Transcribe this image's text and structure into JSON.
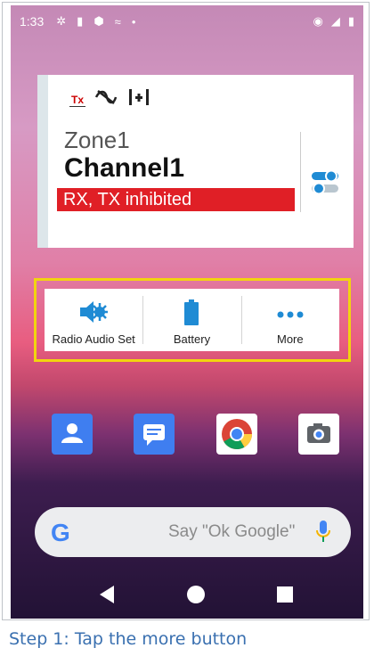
{
  "statusbar": {
    "time": "1:33"
  },
  "widget": {
    "zone": "Zone1",
    "channel": "Channel1",
    "status": "RX, TX inhibited",
    "tx_indicator": "Tx"
  },
  "actions": [
    {
      "label": "Radio Audio Set",
      "icon": "speaker-gear-icon"
    },
    {
      "label": "Battery",
      "icon": "battery-icon"
    },
    {
      "label": "More",
      "icon": "more-dots-icon"
    }
  ],
  "apps": [
    {
      "name": "contacts",
      "icon": "contacts-icon",
      "color": "#3f7ef0"
    },
    {
      "name": "messages",
      "icon": "messages-icon",
      "color": "#3f7ef0"
    },
    {
      "name": "chrome",
      "icon": "chrome-icon",
      "color": "#ffffff"
    },
    {
      "name": "camera",
      "icon": "camera-icon",
      "color": "#ffffff"
    }
  ],
  "search": {
    "placeholder": "Say \"Ok Google\""
  },
  "caption": "Step 1: Tap the more button",
  "colors": {
    "status_red": "#e01f26",
    "highlight": "#f2d40f",
    "caption_blue": "#3a70b0",
    "accent_blue": "#1f8bd4"
  }
}
